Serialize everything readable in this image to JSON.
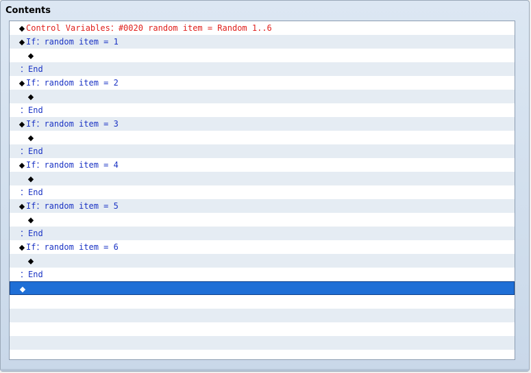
{
  "window": {
    "title": "Contents"
  },
  "rows": [
    {
      "kind": "command",
      "color": "red",
      "indent": 0,
      "marker": "◆",
      "text": "Control Variables：#0020 random item = Random 1..6"
    },
    {
      "kind": "command",
      "color": "blue",
      "indent": 0,
      "marker": "◆",
      "text": "If：random item = 1"
    },
    {
      "kind": "empty",
      "indent": 1,
      "marker": "◆",
      "text": ""
    },
    {
      "kind": "end",
      "color": "blue",
      "indent": 0,
      "marker": "",
      "text": "：End"
    },
    {
      "kind": "command",
      "color": "blue",
      "indent": 0,
      "marker": "◆",
      "text": "If：random item = 2"
    },
    {
      "kind": "empty",
      "indent": 1,
      "marker": "◆",
      "text": ""
    },
    {
      "kind": "end",
      "color": "blue",
      "indent": 0,
      "marker": "",
      "text": "：End"
    },
    {
      "kind": "command",
      "color": "blue",
      "indent": 0,
      "marker": "◆",
      "text": "If：random item = 3"
    },
    {
      "kind": "empty",
      "indent": 1,
      "marker": "◆",
      "text": ""
    },
    {
      "kind": "end",
      "color": "blue",
      "indent": 0,
      "marker": "",
      "text": "：End"
    },
    {
      "kind": "command",
      "color": "blue",
      "indent": 0,
      "marker": "◆",
      "text": "If：random item = 4"
    },
    {
      "kind": "empty",
      "indent": 1,
      "marker": "◆",
      "text": ""
    },
    {
      "kind": "end",
      "color": "blue",
      "indent": 0,
      "marker": "",
      "text": "：End"
    },
    {
      "kind": "command",
      "color": "blue",
      "indent": 0,
      "marker": "◆",
      "text": "If：random item = 5"
    },
    {
      "kind": "empty",
      "indent": 1,
      "marker": "◆",
      "text": ""
    },
    {
      "kind": "end",
      "color": "blue",
      "indent": 0,
      "marker": "",
      "text": "：End"
    },
    {
      "kind": "command",
      "color": "blue",
      "indent": 0,
      "marker": "◆",
      "text": "If：random item = 6"
    },
    {
      "kind": "empty",
      "indent": 1,
      "marker": "◆",
      "text": ""
    },
    {
      "kind": "end",
      "color": "blue",
      "indent": 0,
      "marker": "",
      "text": "：End"
    },
    {
      "kind": "selected",
      "indent": 0,
      "marker": "◆",
      "text": ""
    }
  ],
  "colors": {
    "red": "#e0201c",
    "blue": "#1a33c4",
    "selected": "#1f6fd6"
  }
}
